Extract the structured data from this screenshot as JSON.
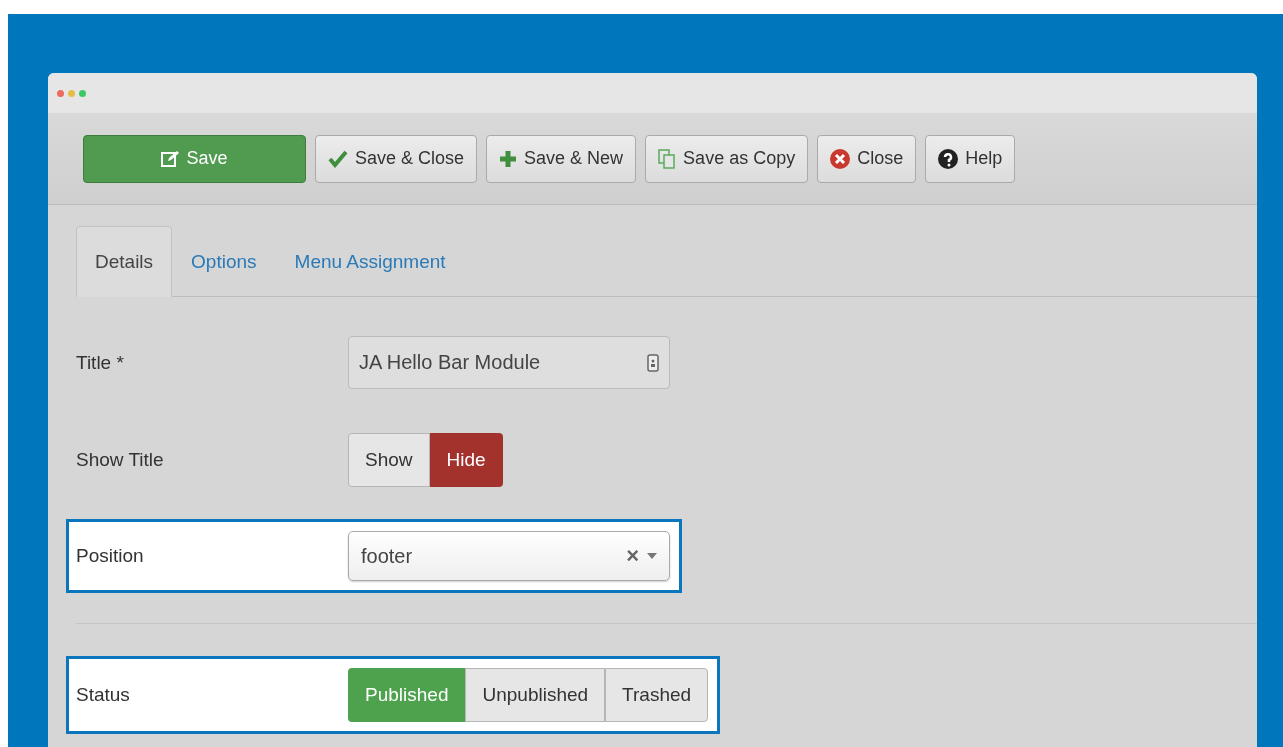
{
  "toolbar": [
    {
      "label": "Save",
      "kind": "primary"
    },
    {
      "label": "Save & Close",
      "kind": "default"
    },
    {
      "label": "Save & New",
      "kind": "default"
    },
    {
      "label": "Save as Copy",
      "kind": "default"
    },
    {
      "label": "Close",
      "kind": "default"
    },
    {
      "label": "Help",
      "kind": "default"
    }
  ],
  "tabs": [
    {
      "label": "Details",
      "selected": true
    },
    {
      "label": "Options",
      "selected": false
    },
    {
      "label": "Menu Assignment",
      "selected": false
    }
  ],
  "fields": [
    {
      "kind": "text",
      "label": "Title *",
      "value": "JA Hello Bar Module",
      "highlighted": false,
      "divider_before": false
    },
    {
      "kind": "toggle",
      "label": "Show Title",
      "highlighted": false,
      "divider_before": false,
      "options": [
        {
          "label": "Show",
          "selected": false,
          "color": "#e6e6e6"
        },
        {
          "label": "Hide",
          "selected": true,
          "color": "#a3322d"
        }
      ]
    },
    {
      "kind": "select",
      "label": "Position",
      "value": "footer",
      "clear": "×",
      "highlighted": true,
      "divider_before": false
    },
    {
      "kind": "toggle",
      "label": "Status",
      "highlighted": true,
      "divider_before": true,
      "options": [
        {
          "label": "Published",
          "selected": true,
          "color": "#4ea24e"
        },
        {
          "label": "Unpublished",
          "selected": false,
          "color": "#e6e6e6"
        },
        {
          "label": "Trashed",
          "selected": false,
          "color": "#e6e6e6"
        }
      ]
    }
  ]
}
